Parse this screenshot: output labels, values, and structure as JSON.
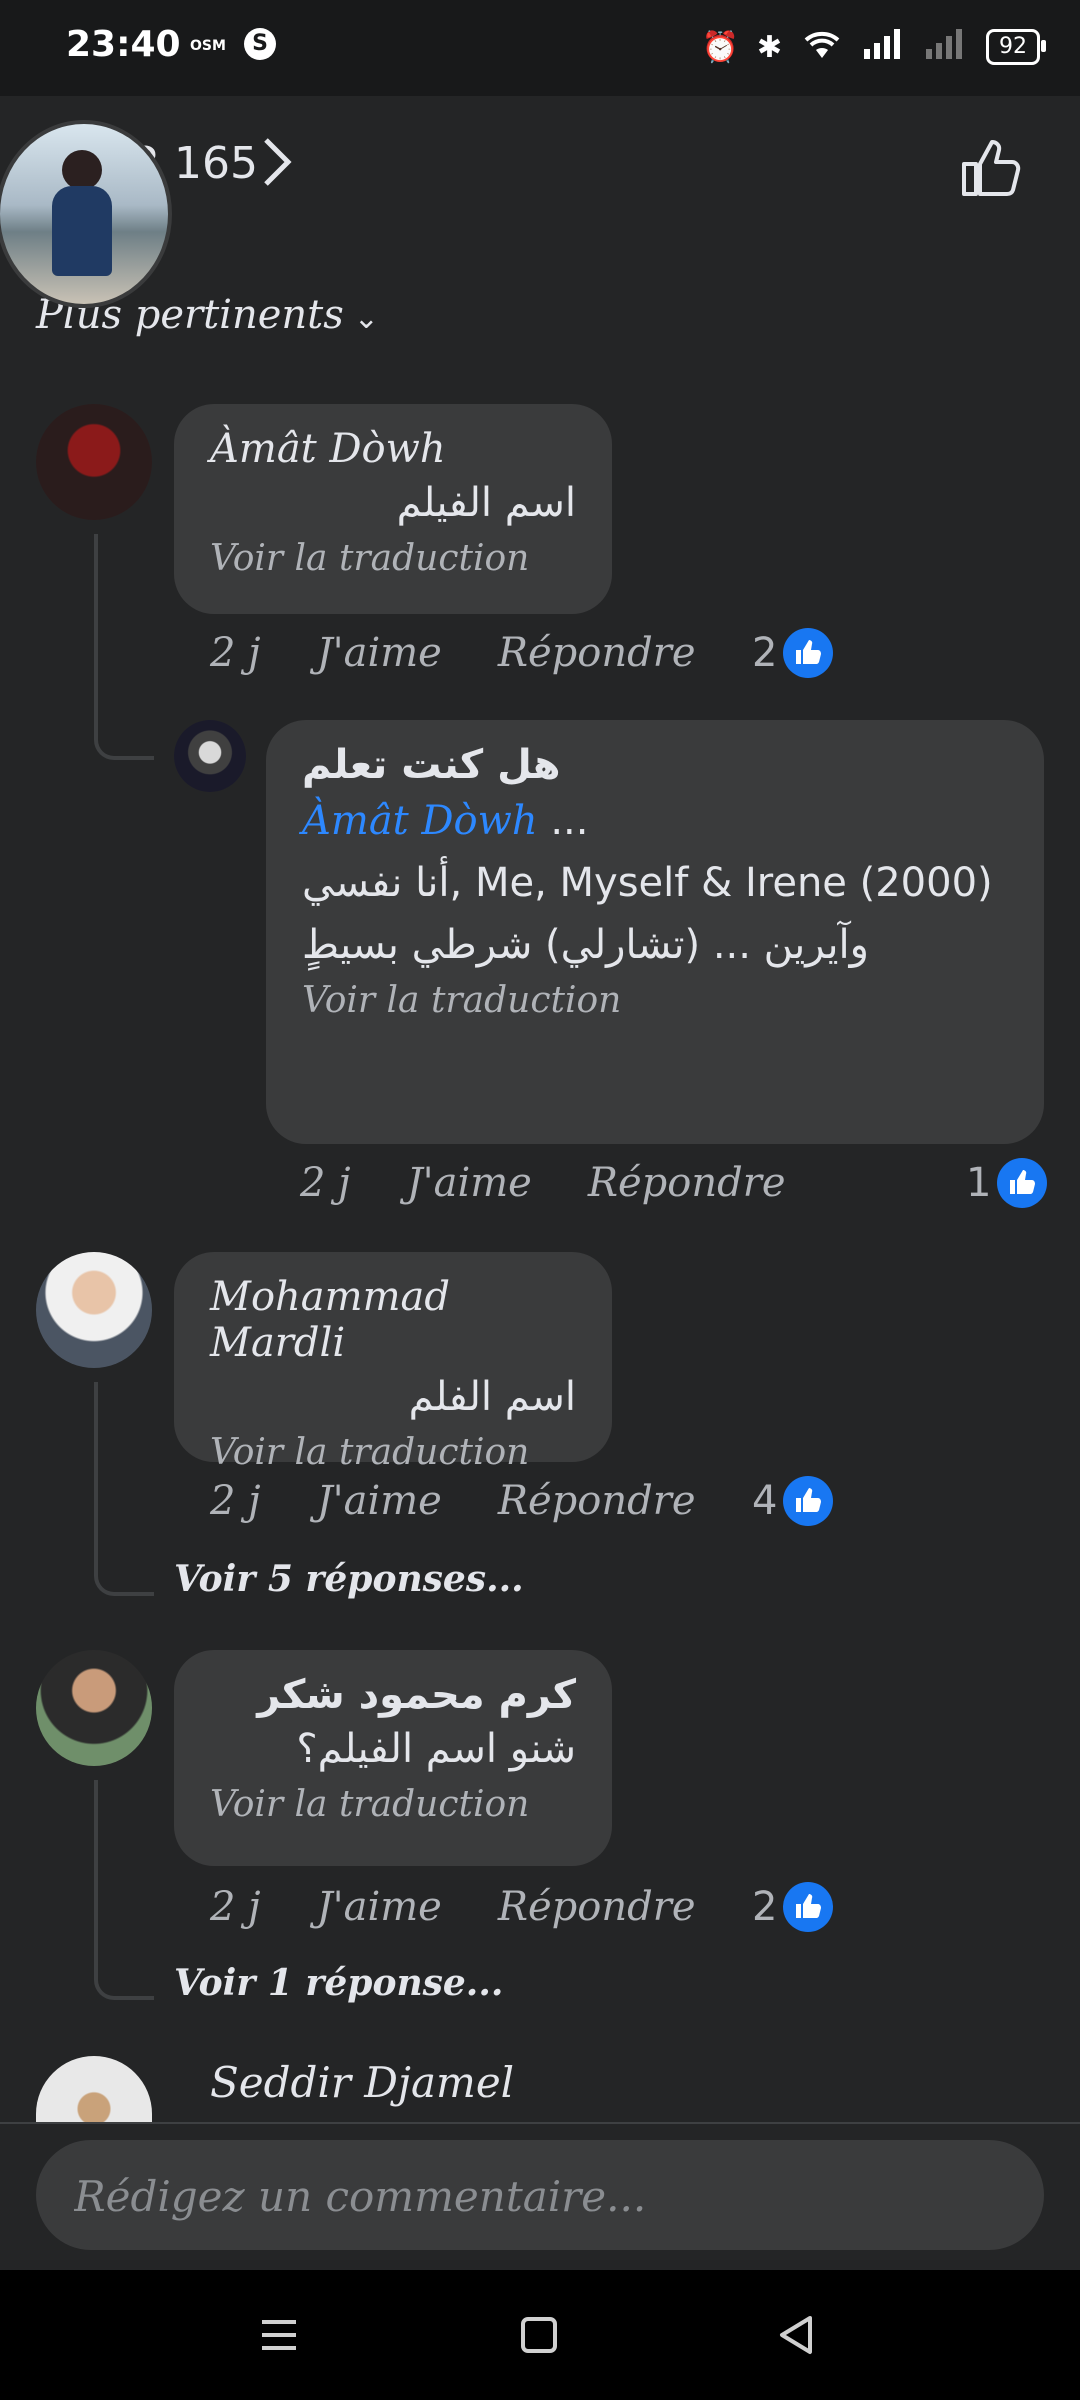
{
  "status_bar": {
    "time": "23:40",
    "carrier_small": "OSM",
    "app_icon_letter": "S",
    "battery": "92"
  },
  "header": {
    "reaction_count": "2 165",
    "sort_label": "Plus pertinents"
  },
  "comments": [
    {
      "author": "Àmât Dòwh",
      "text": "اسم الفيلم",
      "translate": "Voir la traduction",
      "time": "2 j",
      "like": "J'aime",
      "reply": "Répondre",
      "likes": "2"
    },
    {
      "author": "هل كنت تعلم",
      "mention": "Àmât Dòwh",
      "mention_suffix": " ...",
      "text": "Me, Myself & Irene (2000) ,أنا نفسي وآيرين ... (تشارلي) شرطي بسيطٍ",
      "translate": "Voir la traduction",
      "time": "2 j",
      "like": "J'aime",
      "reply": "Répondre",
      "likes": "1"
    },
    {
      "author": "Mohammad Mardli",
      "text": "اسم الفلم",
      "translate": "Voir la traduction",
      "time": "2 j",
      "like": "J'aime",
      "reply": "Répondre",
      "likes": "4",
      "replies_link": "Voir 5 réponses..."
    },
    {
      "author": "كرم محمود شكر",
      "text": "شنو اسم الفيلم؟",
      "translate": "Voir la traduction",
      "time": "2 j",
      "like": "J'aime",
      "reply": "Répondre",
      "likes": "2",
      "replies_link": "Voir 1 réponse..."
    },
    {
      "author": "Seddir Djamel"
    }
  ],
  "composer": {
    "placeholder": "Rédigez un commentaire..."
  },
  "colors": {
    "background": "#242526",
    "bubble": "#3a3b3c",
    "accent": "#1877f2",
    "mention": "#2d88ff"
  }
}
